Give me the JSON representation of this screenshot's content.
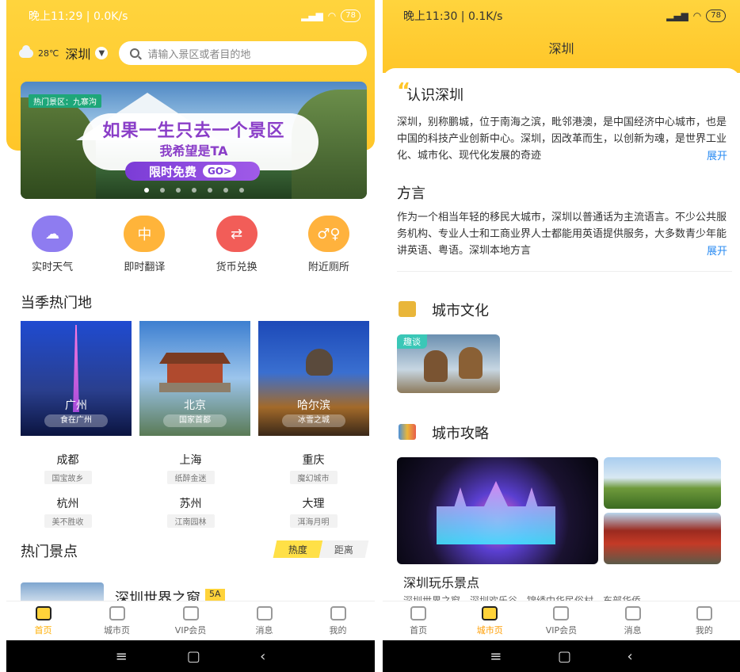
{
  "left": {
    "status": {
      "time": "晚上11:29 | 0.0K/s",
      "battery": "78"
    },
    "location": {
      "temp": "28℃",
      "city": "深圳",
      "search_placeholder": "请输入景区或者目的地"
    },
    "banner": {
      "tag": "热门景区：九寨沟",
      "line1": "如果一生只去一个景区",
      "line2": "我希望是TA",
      "cta": "限时免费",
      "go": "GO>",
      "dot_count": 7,
      "active_dot": 0
    },
    "quick": [
      {
        "label": "实时天气",
        "icon": "weather-icon",
        "color": "#8e7cf0"
      },
      {
        "label": "即时翻译",
        "icon": "translate-icon",
        "color": "#ffb43a"
      },
      {
        "label": "货币兑换",
        "icon": "currency-icon",
        "color": "#f25d58"
      },
      {
        "label": "附近厕所",
        "icon": "toilet-icon",
        "color": "#ffb23d"
      }
    ],
    "season_title": "当季热门地",
    "season_cards": [
      {
        "name": "广州",
        "sub": "食在广州"
      },
      {
        "name": "北京",
        "sub": "国家首都"
      },
      {
        "name": "哈尔滨",
        "sub": "冰雪之城"
      }
    ],
    "cities": [
      {
        "name": "成都",
        "sub": "国宝故乡"
      },
      {
        "name": "上海",
        "sub": "纸醉金迷"
      },
      {
        "name": "重庆",
        "sub": "魔幻城市"
      },
      {
        "name": "杭州",
        "sub": "美不胜收"
      },
      {
        "name": "苏州",
        "sub": "江南园林"
      },
      {
        "name": "大理",
        "sub": "洱海月明"
      }
    ],
    "scenic_title": "热门景点",
    "sort": {
      "hot": "热度",
      "distance": "距离"
    },
    "scenic_first": {
      "name": "深圳世界之窗",
      "level": "5A"
    }
  },
  "tabs": [
    {
      "label": "首页",
      "icon": "home-icon"
    },
    {
      "label": "城市页",
      "icon": "city-icon"
    },
    {
      "label": "VIP会员",
      "icon": "vip-crown-icon"
    },
    {
      "label": "消息",
      "icon": "bell-icon"
    },
    {
      "label": "我的",
      "icon": "profile-icon"
    }
  ],
  "right": {
    "status": {
      "time": "晚上11:30 | 0.1K/s",
      "battery": "78"
    },
    "title": "深圳",
    "know_title": "认识深圳",
    "know_text": "深圳，别称鹏城，位于南海之滨，毗邻港澳，是中国经济中心城市，也是中国的科技产业创新中心。深圳，因改革而生，以创新为魂，是世界工业化、城市化、现代化发展的奇迹",
    "dialect_title": "方言",
    "dialect_text": "作为一个相当年轻的移民大城市，深圳以普通话为主流语言。不少公共服务机构、专业人士和工商业界人士都能用英语提供服务，大多数青少年能讲英语、粤语。深圳本地方言",
    "expand": "展开",
    "culture_title": "城市文化",
    "culture_tag": "趣谈",
    "guide_title": "城市攻略",
    "guide_caption": "深圳玩乐景点",
    "guide_sub": "深圳世界之窗、深圳欢乐谷、锦绣中华民俗村、东部华侨"
  }
}
